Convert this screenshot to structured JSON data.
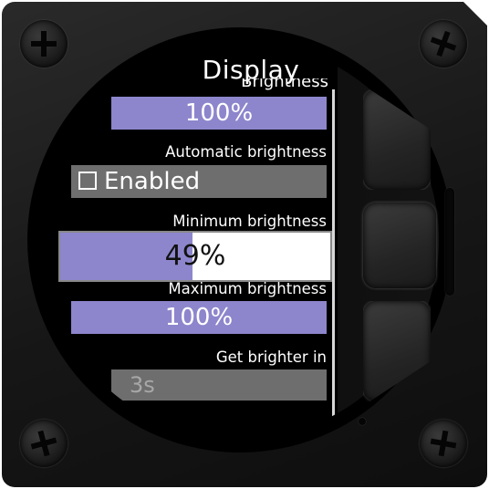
{
  "screen": {
    "title": "Display",
    "partial_label": "Brightness"
  },
  "brightness": {
    "value_text": "100%",
    "level_percent": 100
  },
  "automatic_brightness": {
    "label": "Automatic brightness",
    "checkbox_label": "Enabled",
    "checked": false
  },
  "minimum_brightness": {
    "label": "Minimum brightness",
    "value_text": "49%",
    "level_percent": 49
  },
  "maximum_brightness": {
    "label": "Maximum brightness",
    "value_text": "100%",
    "level_percent": 100
  },
  "get_brighter_in": {
    "label": "Get brighter in",
    "value_text": "3s"
  },
  "colors": {
    "accent": "#8d86cc",
    "field_bg": "#6e6e6e",
    "bezel": "#161616"
  },
  "icons": {
    "screws": "screw-icon",
    "buttons": [
      "up-button",
      "enter-button",
      "down-button"
    ]
  }
}
